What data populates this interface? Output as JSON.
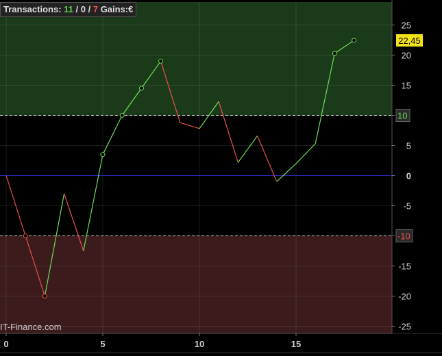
{
  "header": {
    "transactions_label": "Transactions:",
    "winners": "11",
    "sep1": " / ",
    "neutral": "0",
    "sep2": " / ",
    "losers": "7",
    "gains_label": "Gains:",
    "gains_unit": "€"
  },
  "watermark": "IT-Finance.com",
  "colors": {
    "background": "#000000",
    "positive_zone": "#1b3a1a",
    "negative_zone": "#3b1b1b",
    "up_line": "#6ee05a",
    "down_line": "#f0504a",
    "zero_line": "#2c2cc4",
    "last_value_badge": "#f2e316"
  },
  "chart_data": {
    "type": "line",
    "x": [
      0,
      1,
      2,
      3,
      4,
      5,
      6,
      7,
      8,
      9,
      10,
      11,
      12,
      13,
      14,
      15,
      16,
      17,
      18
    ],
    "y": [
      0,
      -10,
      -20,
      -3,
      -12.5,
      3.5,
      10,
      14.5,
      19,
      8.8,
      7.8,
      12.3,
      2.2,
      6.6,
      -1,
      2,
      5.3,
      20.3,
      22.45
    ],
    "markers_at": [
      1,
      2,
      5,
      6,
      7,
      8,
      17,
      18
    ],
    "xlim": [
      0,
      20
    ],
    "ylim": [
      -26,
      29
    ],
    "x_ticks": [
      0,
      5,
      10,
      15
    ],
    "y_ticks": [
      25,
      20,
      15,
      10,
      5,
      0,
      -5,
      -10,
      -15,
      -20,
      -25
    ],
    "upper_threshold": 10,
    "lower_threshold": -10,
    "last_value_label": "22,45",
    "grid": true
  }
}
